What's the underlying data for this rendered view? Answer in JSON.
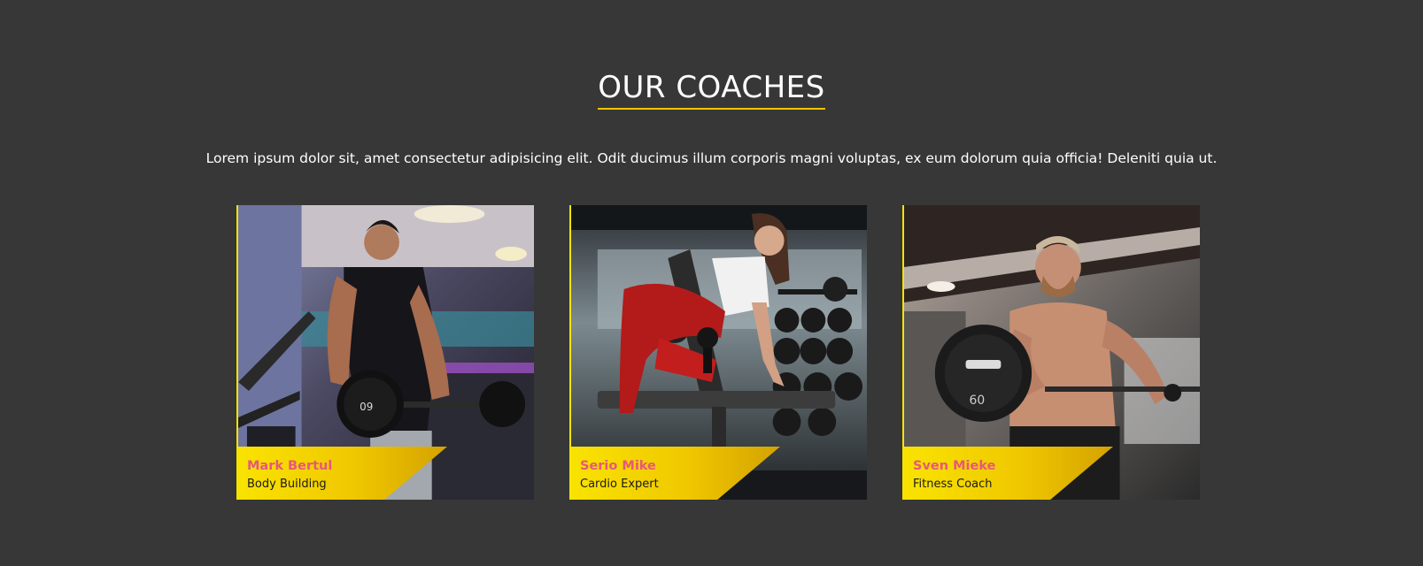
{
  "section": {
    "title": "OUR COACHES",
    "description": "Lorem ipsum dolor sit, amet consectetur adipisicing elit. Odit ducimus illum corporis magni voluptas, ex eum dolorum quia officia! Deleniti quia ut."
  },
  "colors": {
    "background": "#373737",
    "accent": "#f2c300",
    "name": "#e8577a"
  },
  "coaches": [
    {
      "name": "Mark Bertul",
      "role": "Body Building",
      "photo": "man-lifting-barbell-photo"
    },
    {
      "name": "Serio Mike",
      "role": "Cardio Expert",
      "photo": "woman-dumbbell-row-photo"
    },
    {
      "name": "Sven Mieke",
      "role": "Fitness Coach",
      "photo": "man-cable-curl-photo"
    }
  ]
}
